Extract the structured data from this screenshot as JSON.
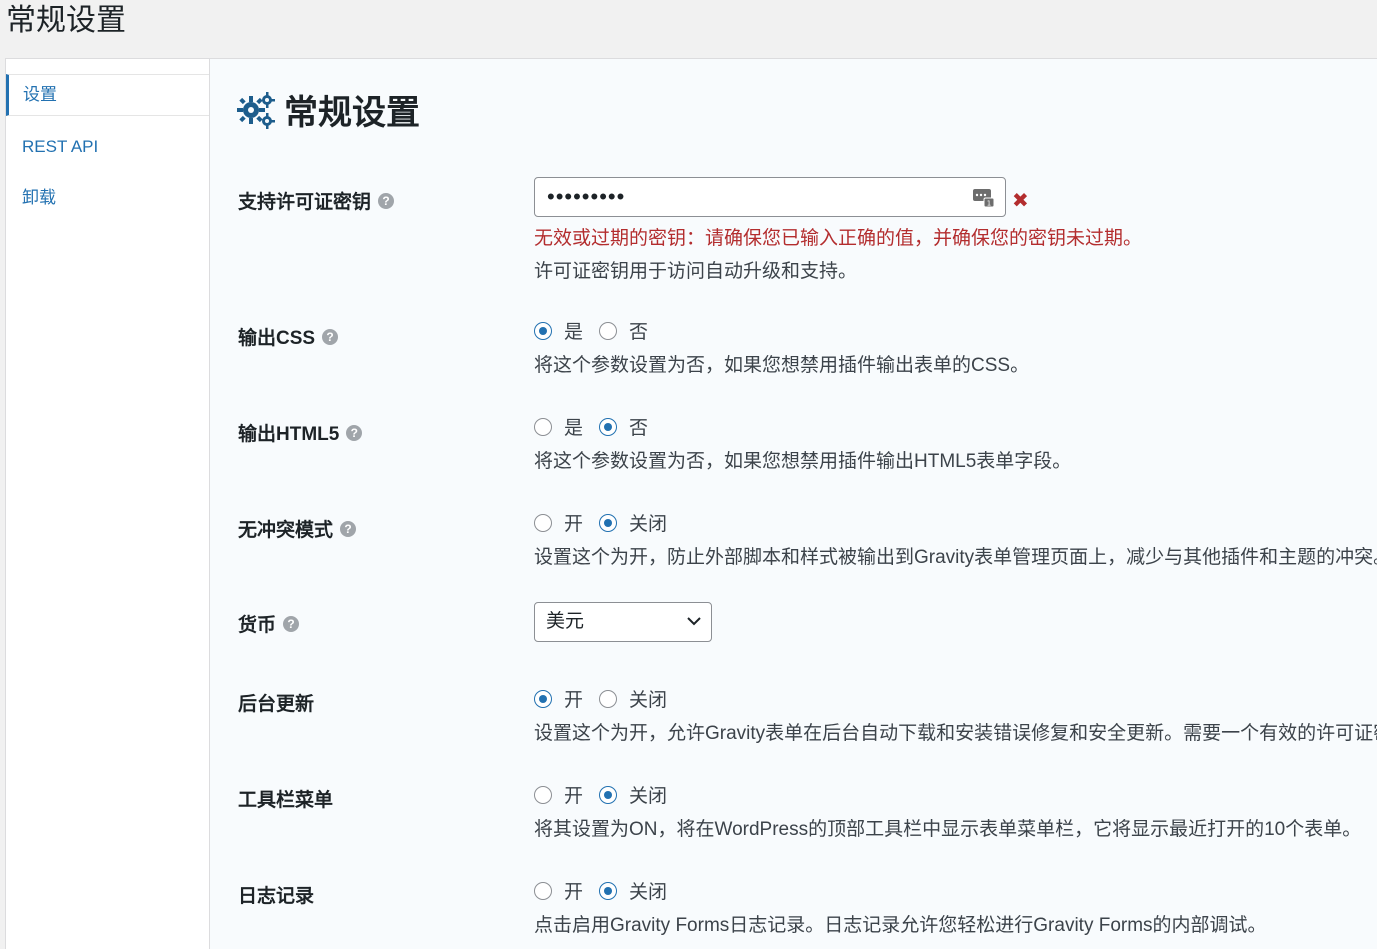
{
  "page": {
    "heading": "常规设置"
  },
  "sidebar": {
    "items": [
      {
        "label": "设置"
      },
      {
        "label": "REST API"
      },
      {
        "label": "卸载"
      }
    ]
  },
  "content": {
    "title": "常规设置",
    "title_icon": "gears-icon",
    "accent_color": "#2271b1",
    "error_color": "#b32d2e"
  },
  "license": {
    "label": "支持许可证密钥",
    "value": "•••••••••",
    "error": "无效或过期的密钥：请确保您已输入正确的值，并确保您的密钥未过期。",
    "desc": "许可证密钥用于访问自动升级和支持。"
  },
  "output_css": {
    "label": "输出CSS",
    "opt1": "是",
    "opt2": "否",
    "selected": "是",
    "desc": "将这个参数设置为否，如果您想禁用插件输出表单的CSS。"
  },
  "output_html5": {
    "label": "输出HTML5",
    "opt1": "是",
    "opt2": "否",
    "selected": "否",
    "desc": "将这个参数设置为否，如果您想禁用插件输出HTML5表单字段。"
  },
  "no_conflict": {
    "label": "无冲突模式",
    "opt1": "开",
    "opt2": "关闭",
    "selected": "关闭",
    "desc": "设置这个为开，防止外部脚本和样式被输出到Gravity表单管理页面上，减少与其他插件和主题的冲突。"
  },
  "currency": {
    "label": "货币",
    "selected": "美元"
  },
  "background_updates": {
    "label": "后台更新",
    "opt1": "开",
    "opt2": "关闭",
    "selected": "开",
    "desc": "设置这个为开，允许Gravity表单在后台自动下载和安装错误修复和安全更新。需要一个有效的许可证密"
  },
  "toolbar_menu": {
    "label": "工具栏菜单",
    "opt1": "开",
    "opt2": "关闭",
    "selected": "关闭",
    "desc": "将其设置为ON，将在WordPress的顶部工具栏中显示表单菜单栏，它将显示最近打开的10个表单。"
  },
  "logging": {
    "label": "日志记录",
    "opt1": "开",
    "opt2": "关闭",
    "selected": "关闭",
    "desc": "点击启用Gravity Forms日志记录。日志记录允许您轻松进行Gravity Forms的内部调试。"
  }
}
